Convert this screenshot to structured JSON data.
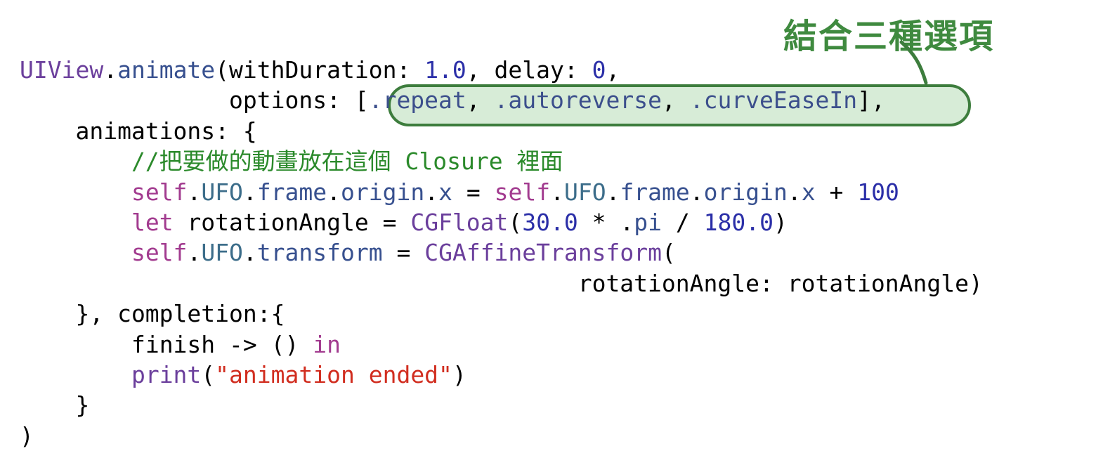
{
  "annotation": {
    "label": "結合三種選項",
    "color": "#3f8a3f",
    "highlight_fill": "#c8e6c8",
    "highlight_border": "#3d7d3d"
  },
  "code": {
    "l1": {
      "a": "UIView",
      "b": ".",
      "c": "animate",
      "d": "(withDuration: ",
      "e": "1.0",
      "f": ", delay: ",
      "g": "0",
      "h": ","
    },
    "l2": {
      "a": "               options: [",
      "b": ".repeat",
      "c": ", ",
      "d": ".autoreverse",
      "e": ", ",
      "f": ".curveEaseIn",
      "g": "],"
    },
    "l3": {
      "a": "    animations: {"
    },
    "l4": {
      "a": "        //把要做的動畫放在這個 Closure 裡面"
    },
    "l5": {
      "indent": "        ",
      "a": "self",
      "b": ".",
      "c": "UFO",
      "d": ".",
      "e": "frame",
      "f": ".",
      "g": "origin",
      "h": ".",
      "i": "x",
      "j": " = ",
      "k": "self",
      "l": ".",
      "m": "UFO",
      "n": ".",
      "o": "frame",
      "p": ".",
      "q": "origin",
      "r": ".",
      "s": "x",
      "t": " + ",
      "u": "100"
    },
    "l6": {
      "indent": "        ",
      "a": "let",
      "b": " rotationAngle = ",
      "c": "CGFloat",
      "d": "(",
      "e": "30.0",
      "f": " * .",
      "g": "pi",
      "h": " / ",
      "i": "180.0",
      "j": ")"
    },
    "l7": {
      "indent": "        ",
      "a": "self",
      "b": ".",
      "c": "UFO",
      "d": ".",
      "e": "transform",
      "f": " = ",
      "g": "CGAffineTransform",
      "h": "("
    },
    "l8": {
      "a": "                                        rotationAngle: rotationAngle)"
    },
    "l9": {
      "a": "    }, completion:{"
    },
    "l10": {
      "indent": "        ",
      "a": "finish -> () ",
      "b": "in"
    },
    "l11": {
      "indent": "        ",
      "a": "print",
      "b": "(",
      "c": "\"animation ended\"",
      "d": ")"
    },
    "l12": {
      "a": "    }"
    },
    "l13": {
      "a": ")"
    }
  },
  "colors": {
    "type": "#6b3f9c",
    "function": "#37508f",
    "number": "#2b2fa8",
    "keyword": "#a23b8f",
    "property": "#3c6d8a",
    "string": "#d12d1f",
    "comment": "#2b8a2b"
  }
}
